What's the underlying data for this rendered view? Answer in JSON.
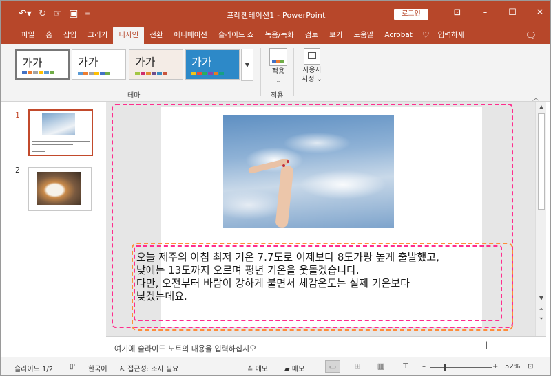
{
  "titlebar": {
    "qat_icons": [
      "undo-icon",
      "redo-icon",
      "touch-mode-icon",
      "save-icon",
      "customize-qat-icon"
    ],
    "title": "프레젠테이션1 - PowerPoint",
    "login": "로그인",
    "controls": [
      "ribbon-display-icon",
      "minimize-icon",
      "maximize-icon",
      "close-icon"
    ]
  },
  "tabs": [
    "파일",
    "홈",
    "삽입",
    "그리기",
    "디자인",
    "전환",
    "애니메이션",
    "슬라이드 쇼",
    "녹음/녹화",
    "검토",
    "보기",
    "도움말",
    "Acrobat"
  ],
  "active_tab": "디자인",
  "tellme": "입력하세",
  "ribbon": {
    "themes": [
      {
        "label": "가가",
        "bg": "#ffffff",
        "text": "#222222",
        "bars": [
          "#4472c4",
          "#ed7d31",
          "#a5a5a5",
          "#ffc000",
          "#5b9bd5",
          "#70ad47"
        ]
      },
      {
        "label": "가가",
        "bg": "#ffffff",
        "text": "#222222",
        "bars": [
          "#5b9bd5",
          "#ed7d31",
          "#a5a5a5",
          "#ffc000",
          "#4472c4",
          "#70ad47"
        ]
      },
      {
        "label": "가가",
        "bg": "#f4ece6",
        "text": "#222222",
        "bars": [
          "#a3c644",
          "#cf2f6f",
          "#e38c32",
          "#6f4e8c",
          "#3a8bbf",
          "#c8553d"
        ]
      },
      {
        "label": "가가",
        "bg": "#2d89c8",
        "text": "#ffffff",
        "bars": [
          "#f0c419",
          "#e84c3d",
          "#27ae60",
          "#8e44ad",
          "#e67e22",
          "#16a085"
        ]
      }
    ],
    "theme_group_label": "테마",
    "variants_button": "적용",
    "variants_group_label": "적용",
    "custom_button": [
      "사용자",
      "지정"
    ]
  },
  "thumbnails": [
    {
      "number": "1",
      "selected": true
    },
    {
      "number": "2",
      "selected": false
    }
  ],
  "slide": {
    "lines": [
      "오늘 제주의 아침 최저 기온 7.7도로 어제보다 8도가량 높게 출발했고,",
      "낮에는 13도까지 오르며 평년 기온을 웃돌겠습니다.",
      "다만, 오전부터 바람이 강하게 불면서 체감온도는 실제 기온보다",
      "낮겠는데요."
    ]
  },
  "notes_placeholder": "여기에 슬라이드 노트의 내용을 입력하십시오",
  "status": {
    "slide_count": "슬라이드 1/2",
    "language": "한국어",
    "accessibility": "접근성: 조사 필요",
    "notes_btn": "메모",
    "comments_btn": "메모",
    "zoom": "52%",
    "zoom_level": 0.52
  }
}
